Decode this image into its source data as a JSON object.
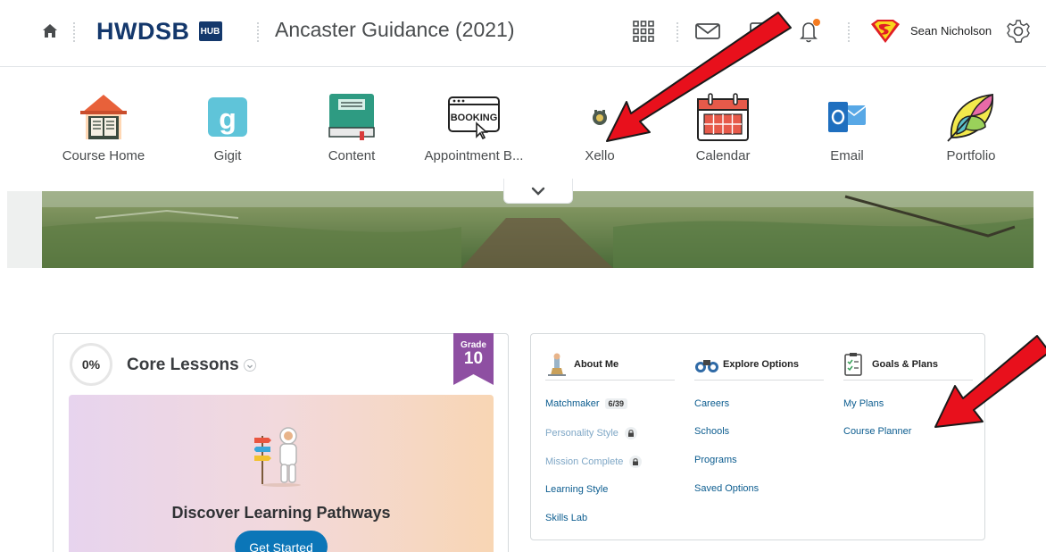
{
  "header": {
    "brand": "HWDSB",
    "brand_badge": "HUB",
    "course_title": "Ancaster Guidance (2021)",
    "user_name": "Sean Nicholson",
    "notification_dot_color": "#f47b20",
    "icons": [
      "home-icon",
      "app-grid-icon",
      "mail-icon",
      "chat-icon",
      "bell-icon",
      "superman-avatar",
      "gear-icon"
    ]
  },
  "nav": {
    "items": [
      {
        "label": "Course Home",
        "icon": "house-book-icon"
      },
      {
        "label": "Gigit",
        "icon": "gigit-icon"
      },
      {
        "label": "Content",
        "icon": "book-icon"
      },
      {
        "label": "Appointment B...",
        "icon": "booking-icon"
      },
      {
        "label": "Xello",
        "icon": "xello-icon"
      },
      {
        "label": "Calendar",
        "icon": "calendar-icon"
      },
      {
        "label": "Email",
        "icon": "outlook-icon"
      },
      {
        "label": "Portfolio",
        "icon": "portfolio-icon"
      }
    ]
  },
  "core": {
    "progress": "0%",
    "title": "Core Lessons",
    "grade_label": "Grade",
    "grade": "10",
    "pathways_title": "Discover Learning Pathways",
    "cta": "Get Started",
    "ribbon_color": "#8e4fa2",
    "button_color": "#0b76b8"
  },
  "explore": {
    "columns": [
      {
        "title": "About Me",
        "links": [
          {
            "label": "Matchmaker",
            "badge": "6/39",
            "locked": false
          },
          {
            "label": "Personality Style",
            "locked": true
          },
          {
            "label": "Mission Complete",
            "locked": true
          },
          {
            "label": "Learning Style",
            "locked": false
          },
          {
            "label": "Skills Lab",
            "locked": false
          }
        ]
      },
      {
        "title": "Explore Options",
        "links": [
          {
            "label": "Careers"
          },
          {
            "label": "Schools"
          },
          {
            "label": "Programs"
          },
          {
            "label": "Saved Options"
          }
        ]
      },
      {
        "title": "Goals & Plans",
        "links": [
          {
            "label": "My Plans"
          },
          {
            "label": "Course Planner"
          }
        ]
      }
    ]
  },
  "annotations": {
    "arrow_color": "#e8101c"
  }
}
